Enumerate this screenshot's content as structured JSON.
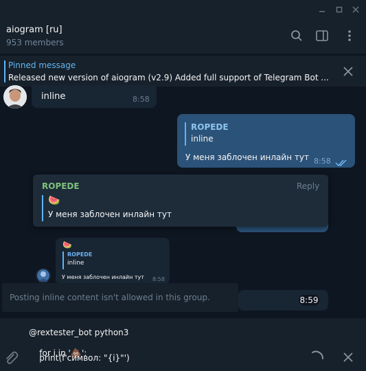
{
  "colors": {
    "accent": "#5eb5f7",
    "background": "#0e1621",
    "incoming": "#182533",
    "outgoing": "#2b5278",
    "sender_green": "#7ec17a"
  },
  "window": {
    "controls": [
      "minimize-icon",
      "maximize-icon",
      "close-icon"
    ]
  },
  "header": {
    "title": "aiogram [ru]",
    "members": "953 members",
    "icons": [
      "search-icon",
      "sidebar-toggle-icon",
      "more-vertical-icon"
    ]
  },
  "pinned": {
    "title": "Pinned message",
    "text": "Released new version of aiogram (v2.9)  Added full support of Telegram Bot ..."
  },
  "messages": {
    "first": {
      "text": "inline",
      "time": "8:58"
    },
    "own": {
      "reply_name": "ROPEDE",
      "reply_text": "inline",
      "text": "У меня заблочен инлайн тут",
      "time": "8:58"
    },
    "small": {
      "emoji": "🍉",
      "reply_name": "ROPEDE",
      "reply_text": "inline",
      "text": "У меня заблочен инлайн тут",
      "time": "8:58"
    },
    "last": {
      "time": "8:59"
    }
  },
  "popup": {
    "sender": "ROPEDE",
    "reply_label": "Reply",
    "emoji": "🍉",
    "text": "У меня заблочен инлайн тут"
  },
  "toast": {
    "text": "Posting inline content isn't allowed in this group."
  },
  "composer": {
    "lines": [
      "@rextester_bot python3",
      "for i in '",
      "':",
      "    print(f'символ: \"{i}\"')"
    ],
    "line2_emoji": "💩",
    "icons": [
      "attach-icon",
      "loading-spinner-icon",
      "cancel-icon"
    ]
  }
}
